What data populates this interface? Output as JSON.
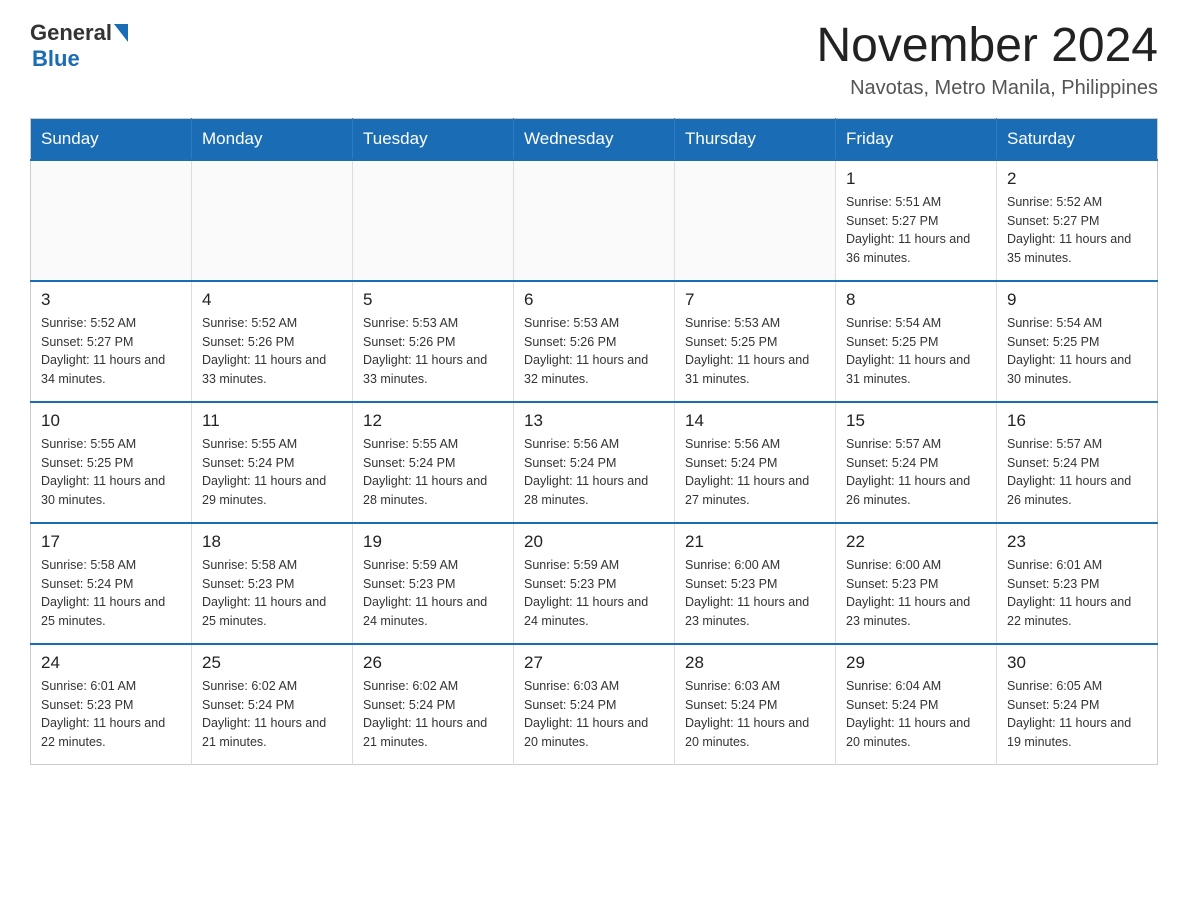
{
  "logo": {
    "general": "General",
    "blue": "Blue"
  },
  "header": {
    "month_title": "November 2024",
    "location": "Navotas, Metro Manila, Philippines"
  },
  "weekdays": [
    "Sunday",
    "Monday",
    "Tuesday",
    "Wednesday",
    "Thursday",
    "Friday",
    "Saturday"
  ],
  "weeks": [
    [
      {
        "day": "",
        "info": ""
      },
      {
        "day": "",
        "info": ""
      },
      {
        "day": "",
        "info": ""
      },
      {
        "day": "",
        "info": ""
      },
      {
        "day": "",
        "info": ""
      },
      {
        "day": "1",
        "info": "Sunrise: 5:51 AM\nSunset: 5:27 PM\nDaylight: 11 hours and 36 minutes."
      },
      {
        "day": "2",
        "info": "Sunrise: 5:52 AM\nSunset: 5:27 PM\nDaylight: 11 hours and 35 minutes."
      }
    ],
    [
      {
        "day": "3",
        "info": "Sunrise: 5:52 AM\nSunset: 5:27 PM\nDaylight: 11 hours and 34 minutes."
      },
      {
        "day": "4",
        "info": "Sunrise: 5:52 AM\nSunset: 5:26 PM\nDaylight: 11 hours and 33 minutes."
      },
      {
        "day": "5",
        "info": "Sunrise: 5:53 AM\nSunset: 5:26 PM\nDaylight: 11 hours and 33 minutes."
      },
      {
        "day": "6",
        "info": "Sunrise: 5:53 AM\nSunset: 5:26 PM\nDaylight: 11 hours and 32 minutes."
      },
      {
        "day": "7",
        "info": "Sunrise: 5:53 AM\nSunset: 5:25 PM\nDaylight: 11 hours and 31 minutes."
      },
      {
        "day": "8",
        "info": "Sunrise: 5:54 AM\nSunset: 5:25 PM\nDaylight: 11 hours and 31 minutes."
      },
      {
        "day": "9",
        "info": "Sunrise: 5:54 AM\nSunset: 5:25 PM\nDaylight: 11 hours and 30 minutes."
      }
    ],
    [
      {
        "day": "10",
        "info": "Sunrise: 5:55 AM\nSunset: 5:25 PM\nDaylight: 11 hours and 30 minutes."
      },
      {
        "day": "11",
        "info": "Sunrise: 5:55 AM\nSunset: 5:24 PM\nDaylight: 11 hours and 29 minutes."
      },
      {
        "day": "12",
        "info": "Sunrise: 5:55 AM\nSunset: 5:24 PM\nDaylight: 11 hours and 28 minutes."
      },
      {
        "day": "13",
        "info": "Sunrise: 5:56 AM\nSunset: 5:24 PM\nDaylight: 11 hours and 28 minutes."
      },
      {
        "day": "14",
        "info": "Sunrise: 5:56 AM\nSunset: 5:24 PM\nDaylight: 11 hours and 27 minutes."
      },
      {
        "day": "15",
        "info": "Sunrise: 5:57 AM\nSunset: 5:24 PM\nDaylight: 11 hours and 26 minutes."
      },
      {
        "day": "16",
        "info": "Sunrise: 5:57 AM\nSunset: 5:24 PM\nDaylight: 11 hours and 26 minutes."
      }
    ],
    [
      {
        "day": "17",
        "info": "Sunrise: 5:58 AM\nSunset: 5:24 PM\nDaylight: 11 hours and 25 minutes."
      },
      {
        "day": "18",
        "info": "Sunrise: 5:58 AM\nSunset: 5:23 PM\nDaylight: 11 hours and 25 minutes."
      },
      {
        "day": "19",
        "info": "Sunrise: 5:59 AM\nSunset: 5:23 PM\nDaylight: 11 hours and 24 minutes."
      },
      {
        "day": "20",
        "info": "Sunrise: 5:59 AM\nSunset: 5:23 PM\nDaylight: 11 hours and 24 minutes."
      },
      {
        "day": "21",
        "info": "Sunrise: 6:00 AM\nSunset: 5:23 PM\nDaylight: 11 hours and 23 minutes."
      },
      {
        "day": "22",
        "info": "Sunrise: 6:00 AM\nSunset: 5:23 PM\nDaylight: 11 hours and 23 minutes."
      },
      {
        "day": "23",
        "info": "Sunrise: 6:01 AM\nSunset: 5:23 PM\nDaylight: 11 hours and 22 minutes."
      }
    ],
    [
      {
        "day": "24",
        "info": "Sunrise: 6:01 AM\nSunset: 5:23 PM\nDaylight: 11 hours and 22 minutes."
      },
      {
        "day": "25",
        "info": "Sunrise: 6:02 AM\nSunset: 5:24 PM\nDaylight: 11 hours and 21 minutes."
      },
      {
        "day": "26",
        "info": "Sunrise: 6:02 AM\nSunset: 5:24 PM\nDaylight: 11 hours and 21 minutes."
      },
      {
        "day": "27",
        "info": "Sunrise: 6:03 AM\nSunset: 5:24 PM\nDaylight: 11 hours and 20 minutes."
      },
      {
        "day": "28",
        "info": "Sunrise: 6:03 AM\nSunset: 5:24 PM\nDaylight: 11 hours and 20 minutes."
      },
      {
        "day": "29",
        "info": "Sunrise: 6:04 AM\nSunset: 5:24 PM\nDaylight: 11 hours and 20 minutes."
      },
      {
        "day": "30",
        "info": "Sunrise: 6:05 AM\nSunset: 5:24 PM\nDaylight: 11 hours and 19 minutes."
      }
    ]
  ]
}
